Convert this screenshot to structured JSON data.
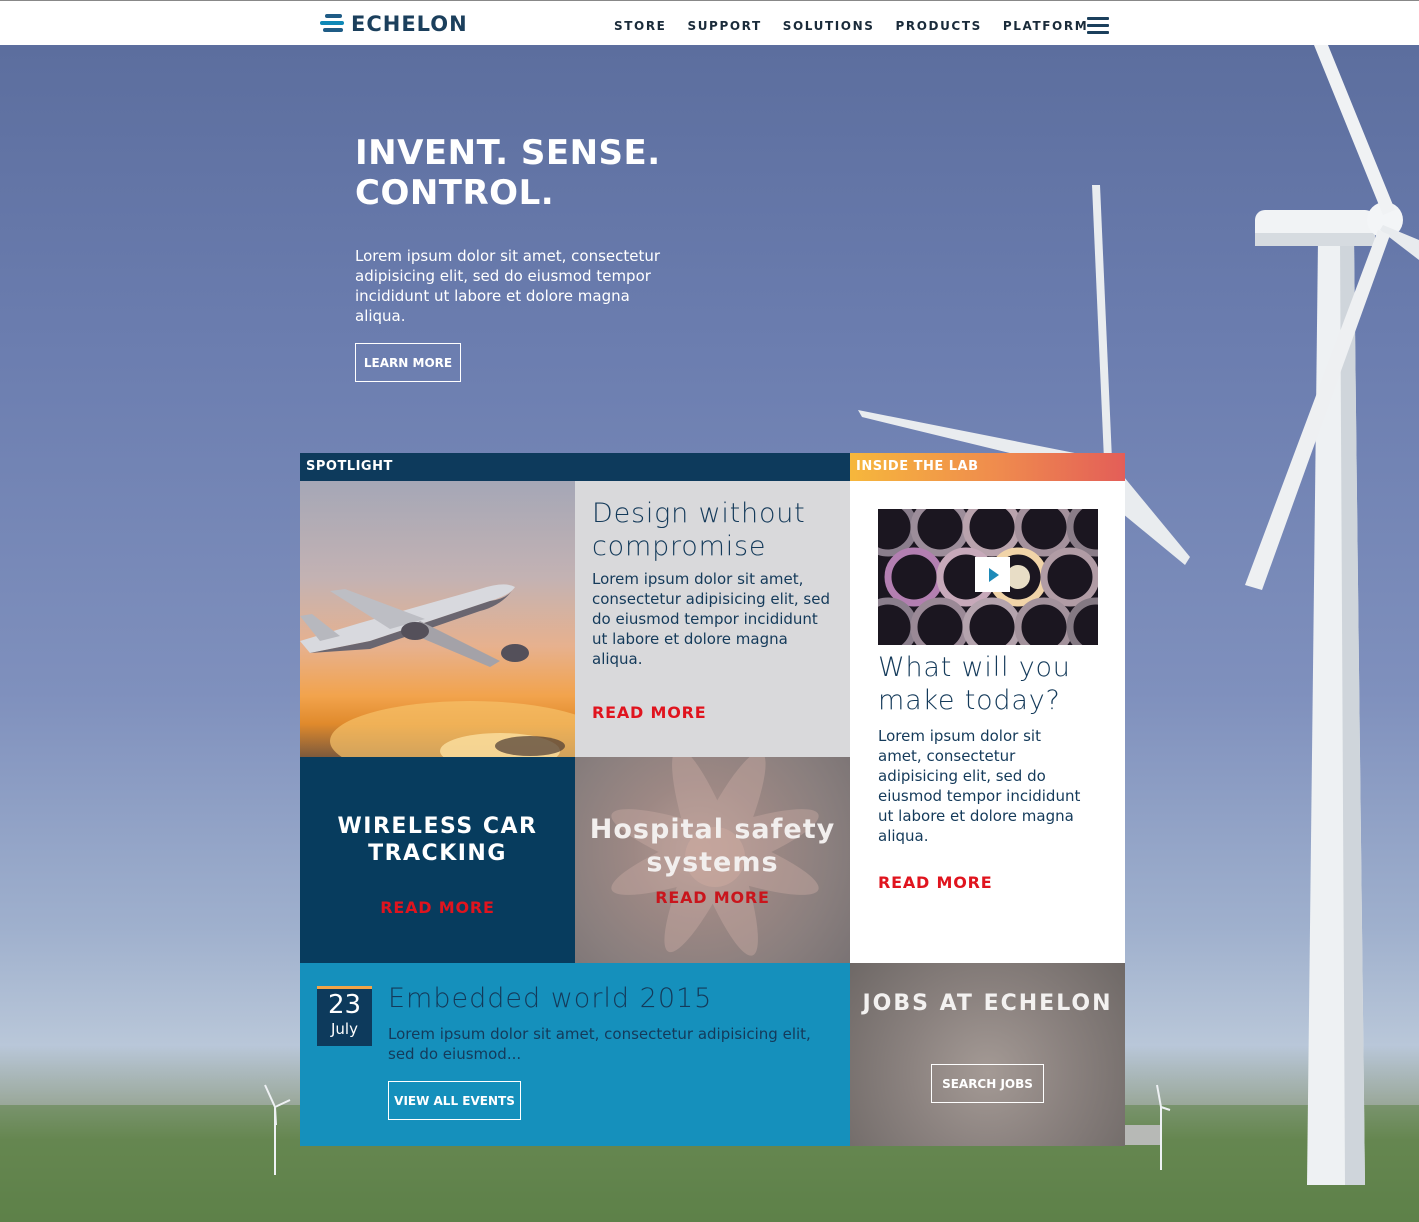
{
  "header": {
    "logo_text": "ECHELON",
    "nav": [
      "STORE",
      "SUPPORT",
      "SOLUTIONS",
      "PRODUCTS",
      "PLATFORM"
    ],
    "menu_icon": "hamburger-menu-icon"
  },
  "hero": {
    "title_line1": "INVENT. SENSE.",
    "title_line2": "CONTROL.",
    "body": "Lorem ipsum dolor sit amet, consectetur adipisicing elit, sed do eiusmod tempor incididunt ut labore et dolore magna aliqua.",
    "button": "LEARN MORE"
  },
  "spotlight": {
    "label": "SPOTLIGHT",
    "feature": {
      "title": "Design without compromise",
      "body": "Lorem ipsum dolor sit amet, consectetur adipisicing elit, sed do eiusmod tempor incididunt ut labore et dolore magna aliqua.",
      "link": "READ MORE"
    },
    "wireless": {
      "title": "WIRELESS CAR TRACKING",
      "link": "READ MORE"
    },
    "hospital": {
      "title": "Hospital safety systems",
      "link": "READ MORE"
    }
  },
  "lab": {
    "label": "INSIDE THE LAB",
    "title": "What will you make today?",
    "body": "Lorem ipsum dolor sit amet, consectetur adipisicing elit, sed do eiusmod tempor incididunt ut labore et dolore magna aliqua.",
    "link": "READ MORE"
  },
  "events": {
    "day": "23",
    "month": "July",
    "title": "Embedded world 2015",
    "body": "Lorem ipsum dolor sit amet, consectetur adipisicing elit, sed do eiusmod...",
    "button": "VIEW ALL EVENTS"
  },
  "jobs": {
    "title": "JOBS AT ECHELON",
    "button": "SEARCH JOBS"
  },
  "colors": {
    "navy": "#0d3a5c",
    "teal": "#1590bc",
    "read_more": "#e0141e",
    "lab_gradient_start": "#f6b73c",
    "lab_gradient_end": "#e35e58"
  }
}
